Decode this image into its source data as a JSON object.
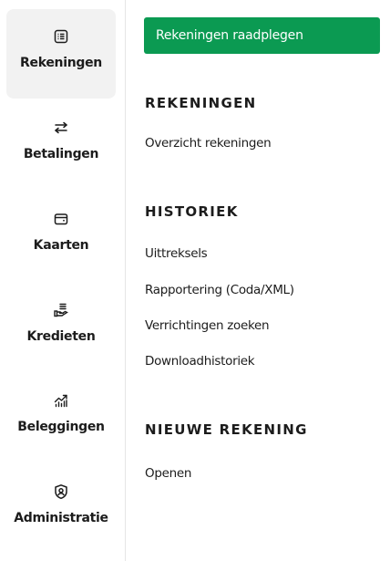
{
  "sidebar": {
    "items": [
      {
        "label": "Rekeningen",
        "icon": "list-document-icon",
        "active": true
      },
      {
        "label": "Betalingen",
        "icon": "transfer-arrows-icon",
        "active": false
      },
      {
        "label": "Kaarten",
        "icon": "wallet-card-icon",
        "active": false
      },
      {
        "label": "Kredieten",
        "icon": "hand-coins-icon",
        "active": false
      },
      {
        "label": "Beleggingen",
        "icon": "chart-growth-icon",
        "active": false
      },
      {
        "label": "Administratie",
        "icon": "shield-user-icon",
        "active": false
      }
    ]
  },
  "main": {
    "cta_label": "Rekeningen raadplegen",
    "sections": [
      {
        "title": "REKENINGEN",
        "links": [
          "Overzicht rekeningen"
        ]
      },
      {
        "title": "HISTORIEK",
        "links": [
          "Uittreksels",
          "Rapportering (Coda/XML)",
          "Verrichtingen zoeken",
          "Downloadhistoriek"
        ]
      },
      {
        "title": "NIEUWE REKENING",
        "links": [
          "Openen"
        ]
      }
    ]
  },
  "colors": {
    "accent": "#0b9a52",
    "active_bg": "#f2f2f2",
    "text": "#1c1c1c"
  }
}
